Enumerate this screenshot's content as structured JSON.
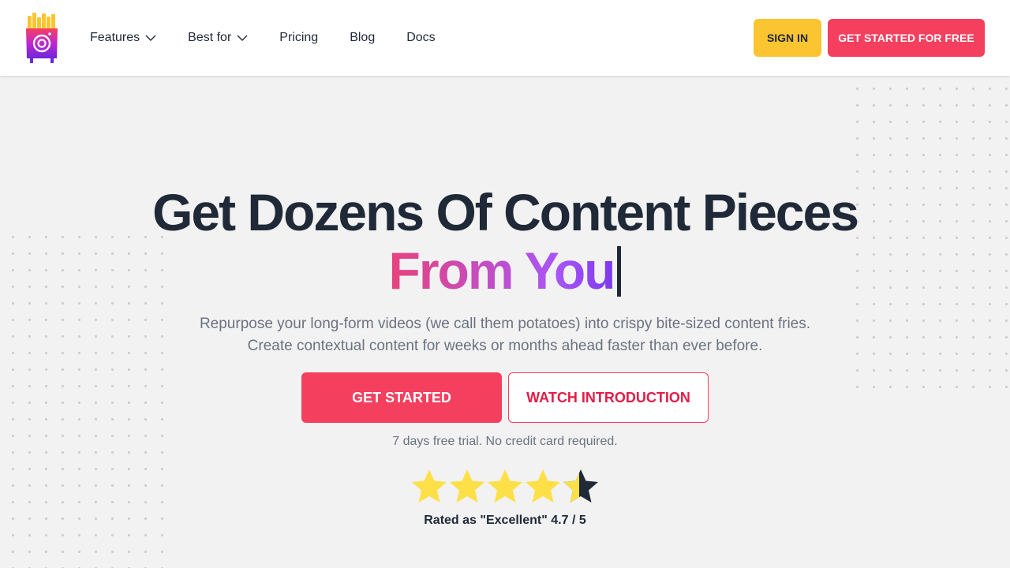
{
  "header": {
    "nav": [
      {
        "label": "Features",
        "has_dropdown": true
      },
      {
        "label": "Best for",
        "has_dropdown": true
      },
      {
        "label": "Pricing",
        "has_dropdown": false
      },
      {
        "label": "Blog",
        "has_dropdown": false
      },
      {
        "label": "Docs",
        "has_dropdown": false
      }
    ],
    "signin_label": "SIGN IN",
    "cta_label": "GET STARTED FOR FREE"
  },
  "hero": {
    "headline_line1": "Get Dozens Of Content Pieces",
    "headline_line2": "From You",
    "subtext": "Repurpose your long-form videos (we call them potatoes) into crispy bite-sized content fries. Create contextual content for weeks or months ahead faster than ever before.",
    "primary_button": "GET STARTED",
    "secondary_button": "WATCH INTRODUCTION",
    "trial_note": "7 days free trial. No credit card required.",
    "rating_text": "Rated as \"Excellent\" 4.7 / 5",
    "rating_value": 4.7,
    "rating_max": 5
  },
  "colors": {
    "accent": "#f43f5e",
    "signin": "#fbc531",
    "star": "#fde047",
    "star_empty": "#1f2937",
    "background": "#f2f2f2"
  },
  "icons": {
    "logo": "fries-camera-logo-icon",
    "dropdown": "chevron-down-icon",
    "star": "star-icon"
  }
}
